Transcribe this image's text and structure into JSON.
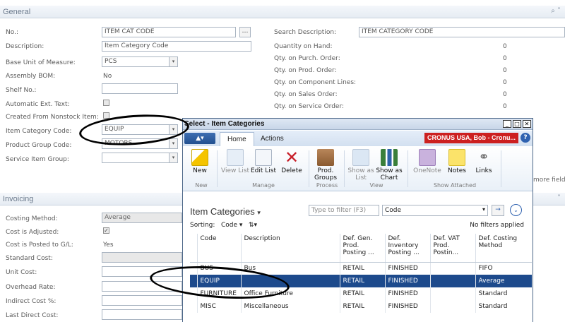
{
  "general": {
    "title": "General",
    "fields": {
      "no_label": "No.:",
      "no_value": "ITEM CAT CODE",
      "description_label": "Description:",
      "description_value": "Item Category Code",
      "base_uom_label": "Base Unit of Measure:",
      "base_uom_value": "PCS",
      "assembly_bom_label": "Assembly BOM:",
      "assembly_bom_value": "No",
      "shelf_no_label": "Shelf No.:",
      "auto_ext_text_label": "Automatic Ext. Text:",
      "nonstock_label": "Created From Nonstock Item:",
      "item_category_label": "Item Category Code:",
      "item_category_value": "EQUIP",
      "product_group_label": "Product Group Code:",
      "product_group_value": "MOTORS",
      "service_item_group_label": "Service Item Group:"
    },
    "right": {
      "search_desc_label": "Search Description:",
      "search_desc_value": "ITEM CATEGORY CODE",
      "qty_on_hand_label": "Quantity on Hand:",
      "qty_on_hand": "0",
      "qty_purch_label": "Qty. on Purch. Order:",
      "qty_purch": "0",
      "qty_prod_label": "Qty. on Prod. Order:",
      "qty_prod": "0",
      "qty_comp_label": "Qty. on Component Lines:",
      "qty_comp": "0",
      "qty_sales_label": "Qty. on Sales Order:",
      "qty_sales": "0",
      "qty_service_label": "Qty. on Service Order:",
      "qty_service": "0"
    },
    "more_fields": "more fields"
  },
  "invoicing": {
    "title": "Invoicing",
    "costing_method_label": "Costing Method:",
    "costing_method_value": "Average",
    "cost_adjusted_label": "Cost is Adjusted:",
    "cost_posted_label": "Cost is Posted to G/L:",
    "cost_posted_value": "Yes",
    "standard_cost_label": "Standard Cost:",
    "unit_cost_label": "Unit Cost:",
    "overhead_rate_label": "Overhead Rate:",
    "indirect_cost_label": "Indirect Cost %:",
    "last_direct_cost_label": "Last Direct Cost:"
  },
  "dialog": {
    "title": "Select - Item Categories",
    "tabs": [
      "Home",
      "Actions"
    ],
    "company": "CRONUS USA, Bob - Cronu...",
    "ribbon": {
      "new": "New",
      "view_list": "View List",
      "edit_list": "Edit List",
      "delete": "Delete",
      "prod_groups": "Prod. Groups",
      "show_as_list": "Show as List",
      "show_as_chart": "Show as Chart",
      "onenote": "OneNote",
      "notes": "Notes",
      "links": "Links",
      "groups": [
        "New",
        "Manage",
        "Process",
        "View",
        "Show Attached"
      ]
    },
    "list_title": "Item Categories",
    "filter_placeholder": "Type to filter (F3)",
    "filter_field": "Code",
    "sorting_label": "Sorting:",
    "sorting_value": "Code",
    "no_filters": "No filters applied",
    "columns": [
      "Code",
      "Description",
      "Def. Gen. Prod. Posting ...",
      "Def. Inventory Posting ...",
      "Def. VAT Prod. Postin...",
      "Def. Costing Method"
    ],
    "rows": [
      [
        "BUS",
        "Bus",
        "RETAIL",
        "FINISHED",
        "",
        "FIFO"
      ],
      [
        "EQUIP",
        "",
        "RETAIL",
        "FINISHED",
        "",
        "Average"
      ],
      [
        "FURNITURE",
        "Office Furniture",
        "RETAIL",
        "FINISHED",
        "",
        "Standard"
      ],
      [
        "MISC",
        "Miscellaneous",
        "RETAIL",
        "FINISHED",
        "",
        "Standard"
      ]
    ]
  },
  "colors": {
    "selection": "#1d4a8c",
    "company_badge": "#cc2020",
    "annotation": "#000000"
  }
}
